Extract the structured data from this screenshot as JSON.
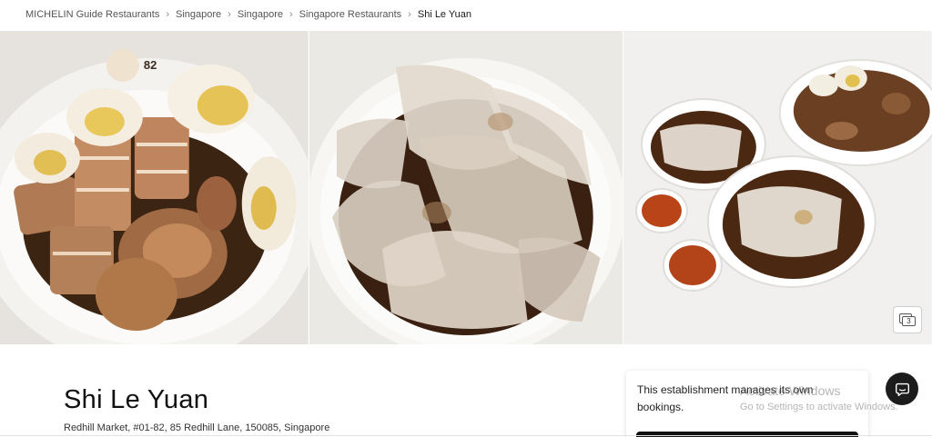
{
  "breadcrumb": {
    "items": [
      {
        "label": "MICHELIN Guide Restaurants"
      },
      {
        "label": "Singapore"
      },
      {
        "label": "Singapore"
      },
      {
        "label": "Singapore Restaurants"
      },
      {
        "label": "Shi Le Yuan"
      }
    ],
    "separator_icon": "chevron-right-icon"
  },
  "gallery": {
    "photo_count": "3",
    "photos": [
      {
        "subject": "braised-pork-eggs-intestines"
      },
      {
        "subject": "kway-chap-soup"
      },
      {
        "subject": "kway-chap-set-top-view"
      }
    ],
    "stamp_text": "82"
  },
  "restaurant": {
    "name": "Shi Le Yuan",
    "address": "Redhill Market, #01-82, 85 Redhill Lane, 150085, Singapore"
  },
  "booking": {
    "message": "This establishment manages its own bookings."
  },
  "os_watermark": {
    "title": "Activate Windows",
    "subtitle": "Go to Settings to activate Windows."
  },
  "icons": {
    "chat": "chat-bubble-icon",
    "gallery": "photo-stack-icon"
  },
  "colors": {
    "chat_button": "#1c1c1c",
    "book_button": "#111111",
    "broth": "#3a2010"
  }
}
